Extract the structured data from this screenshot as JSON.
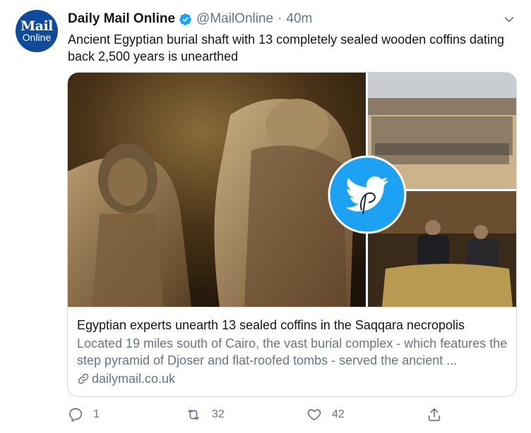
{
  "tweet": {
    "author": {
      "avatar_line1": "Mail",
      "avatar_line2": "Online",
      "name": "Daily Mail Online",
      "handle": "@MailOnline",
      "separator": "·",
      "time": "40m",
      "verified": true
    },
    "text": "Ancient Egyptian burial shaft with 13 completely sealed wooden coffins dating back 2,500 years is unearthed",
    "card": {
      "title": "Egyptian experts unearth 13 sealed coffins in the Saqqara necropolis",
      "description": "Located 19 miles south of Cairo, the vast burial complex - which features the step pyramid of Djoser and flat-roofed tombs - served the ancient ...",
      "domain": "dailymail.co.uk"
    },
    "actions": {
      "replies": "1",
      "retweets": "32",
      "likes": "42"
    }
  },
  "icons": [
    "verified-badge-icon",
    "chevron-down-icon",
    "link-icon",
    "reply-icon",
    "retweet-icon",
    "like-icon",
    "share-icon",
    "twitter-bird-icon"
  ],
  "colors": {
    "brand_blue": "#1da1f2",
    "avatar_bg": "#0f4b9a",
    "secondary_text": "#657786",
    "border": "#cfd9de"
  }
}
